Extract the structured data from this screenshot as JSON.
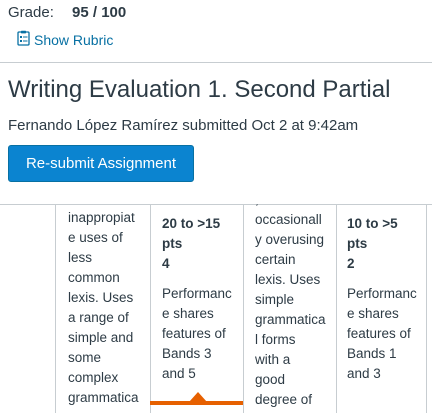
{
  "grade": {
    "label": "Grade:",
    "value": "95 / 100"
  },
  "show_rubric": {
    "label": "Show Rubric",
    "icon": "rubric-icon"
  },
  "assignment": {
    "title": "Writing Evaluation 1. Second Partial",
    "submitted_text": "Fernando López Ramírez submitted Oct 2 at 9:42am",
    "resubmit_label": "Re-submit Assignment"
  },
  "colors": {
    "accent": "#0b84d0",
    "link": "#0770a3",
    "selected": "#e66000"
  },
  "rubric": {
    "columns": [
      {
        "lines": [
          "inappropiat",
          "e uses of",
          "less",
          "common",
          "lexis. Uses",
          "a range of",
          "simple and",
          "some",
          "complex",
          "grammatica"
        ]
      },
      {
        "range": "20 to >15",
        "pts_label": "pts",
        "points": "4",
        "description_lines": [
          "Performanc",
          "e shares",
          "features of",
          "Bands 3",
          "and 5"
        ],
        "selected": true
      },
      {
        "lines": [
          ",",
          "occasionall",
          "y overusing",
          "certain",
          "lexis. Uses",
          "simple",
          "grammatica",
          "l forms",
          "with a",
          "good",
          "degree of"
        ]
      },
      {
        "range": "10 to >5",
        "pts_label": "pts",
        "points": "2",
        "description_lines": [
          "Performanc",
          "e shares",
          "features of",
          "Bands 1",
          "and 3"
        ],
        "selected": false
      }
    ]
  }
}
